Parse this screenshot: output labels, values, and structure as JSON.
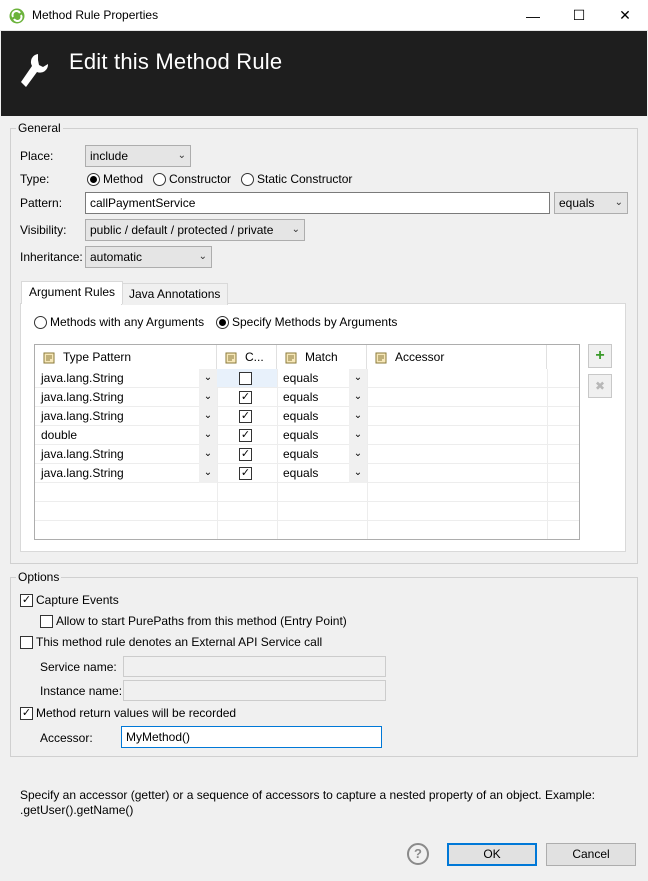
{
  "window": {
    "title": "Method Rule Properties",
    "minimize": "—",
    "maximize": "☐",
    "close": "✕"
  },
  "banner": {
    "title": "Edit this Method Rule"
  },
  "general": {
    "label": "General",
    "place_label": "Place:",
    "place_value": "include",
    "type_label": "Type:",
    "type_options": [
      "Method",
      "Constructor",
      "Static Constructor"
    ],
    "type_selected": "Method",
    "pattern_label": "Pattern:",
    "pattern_value": "callPaymentService",
    "pattern_match": "equals",
    "visibility_label": "Visibility:",
    "visibility_value": "public / default / protected / private",
    "inheritance_label": "Inheritance:",
    "inheritance_value": "automatic"
  },
  "tabs": [
    "Argument Rules",
    "Java Annotations"
  ],
  "argument_rules": {
    "mode_any": "Methods with any Arguments",
    "mode_specify": "Specify Methods by Arguments",
    "columns": [
      "Type Pattern",
      "C...",
      "Match",
      "Accessor"
    ],
    "rows": [
      {
        "type": "java.lang.String",
        "checked": false,
        "match": "equals",
        "accessor": ""
      },
      {
        "type": "java.lang.String",
        "checked": true,
        "match": "equals",
        "accessor": ""
      },
      {
        "type": "java.lang.String",
        "checked": true,
        "match": "equals",
        "accessor": ""
      },
      {
        "type": "double",
        "checked": true,
        "match": "equals",
        "accessor": ""
      },
      {
        "type": "java.lang.String",
        "checked": true,
        "match": "equals",
        "accessor": ""
      },
      {
        "type": "java.lang.String",
        "checked": true,
        "match": "equals",
        "accessor": ""
      }
    ],
    "add_icon": "+",
    "remove_icon": "✖"
  },
  "options": {
    "label": "Options",
    "capture_events": "Capture Events",
    "capture_events_checked": true,
    "allow_purepaths": "Allow to start PurePaths from this method (Entry Point)",
    "allow_purepaths_checked": false,
    "external_api": "This method rule denotes an External API Service call",
    "external_api_checked": false,
    "service_name_label": "Service name:",
    "instance_name_label": "Instance name:",
    "return_values": "Method return values will be recorded",
    "return_values_checked": true,
    "accessor_label": "Accessor:",
    "accessor_value": "MyMethod()"
  },
  "help_text_line1": "Specify an accessor (getter) or a sequence of accessors to capture a nested property of an object. Example:",
  "help_text_line2": ".getUser().getName()",
  "footer": {
    "help_icon": "?",
    "ok": "OK",
    "cancel": "Cancel"
  },
  "check_glyph": "✓",
  "arrow_glyph": "⌄"
}
